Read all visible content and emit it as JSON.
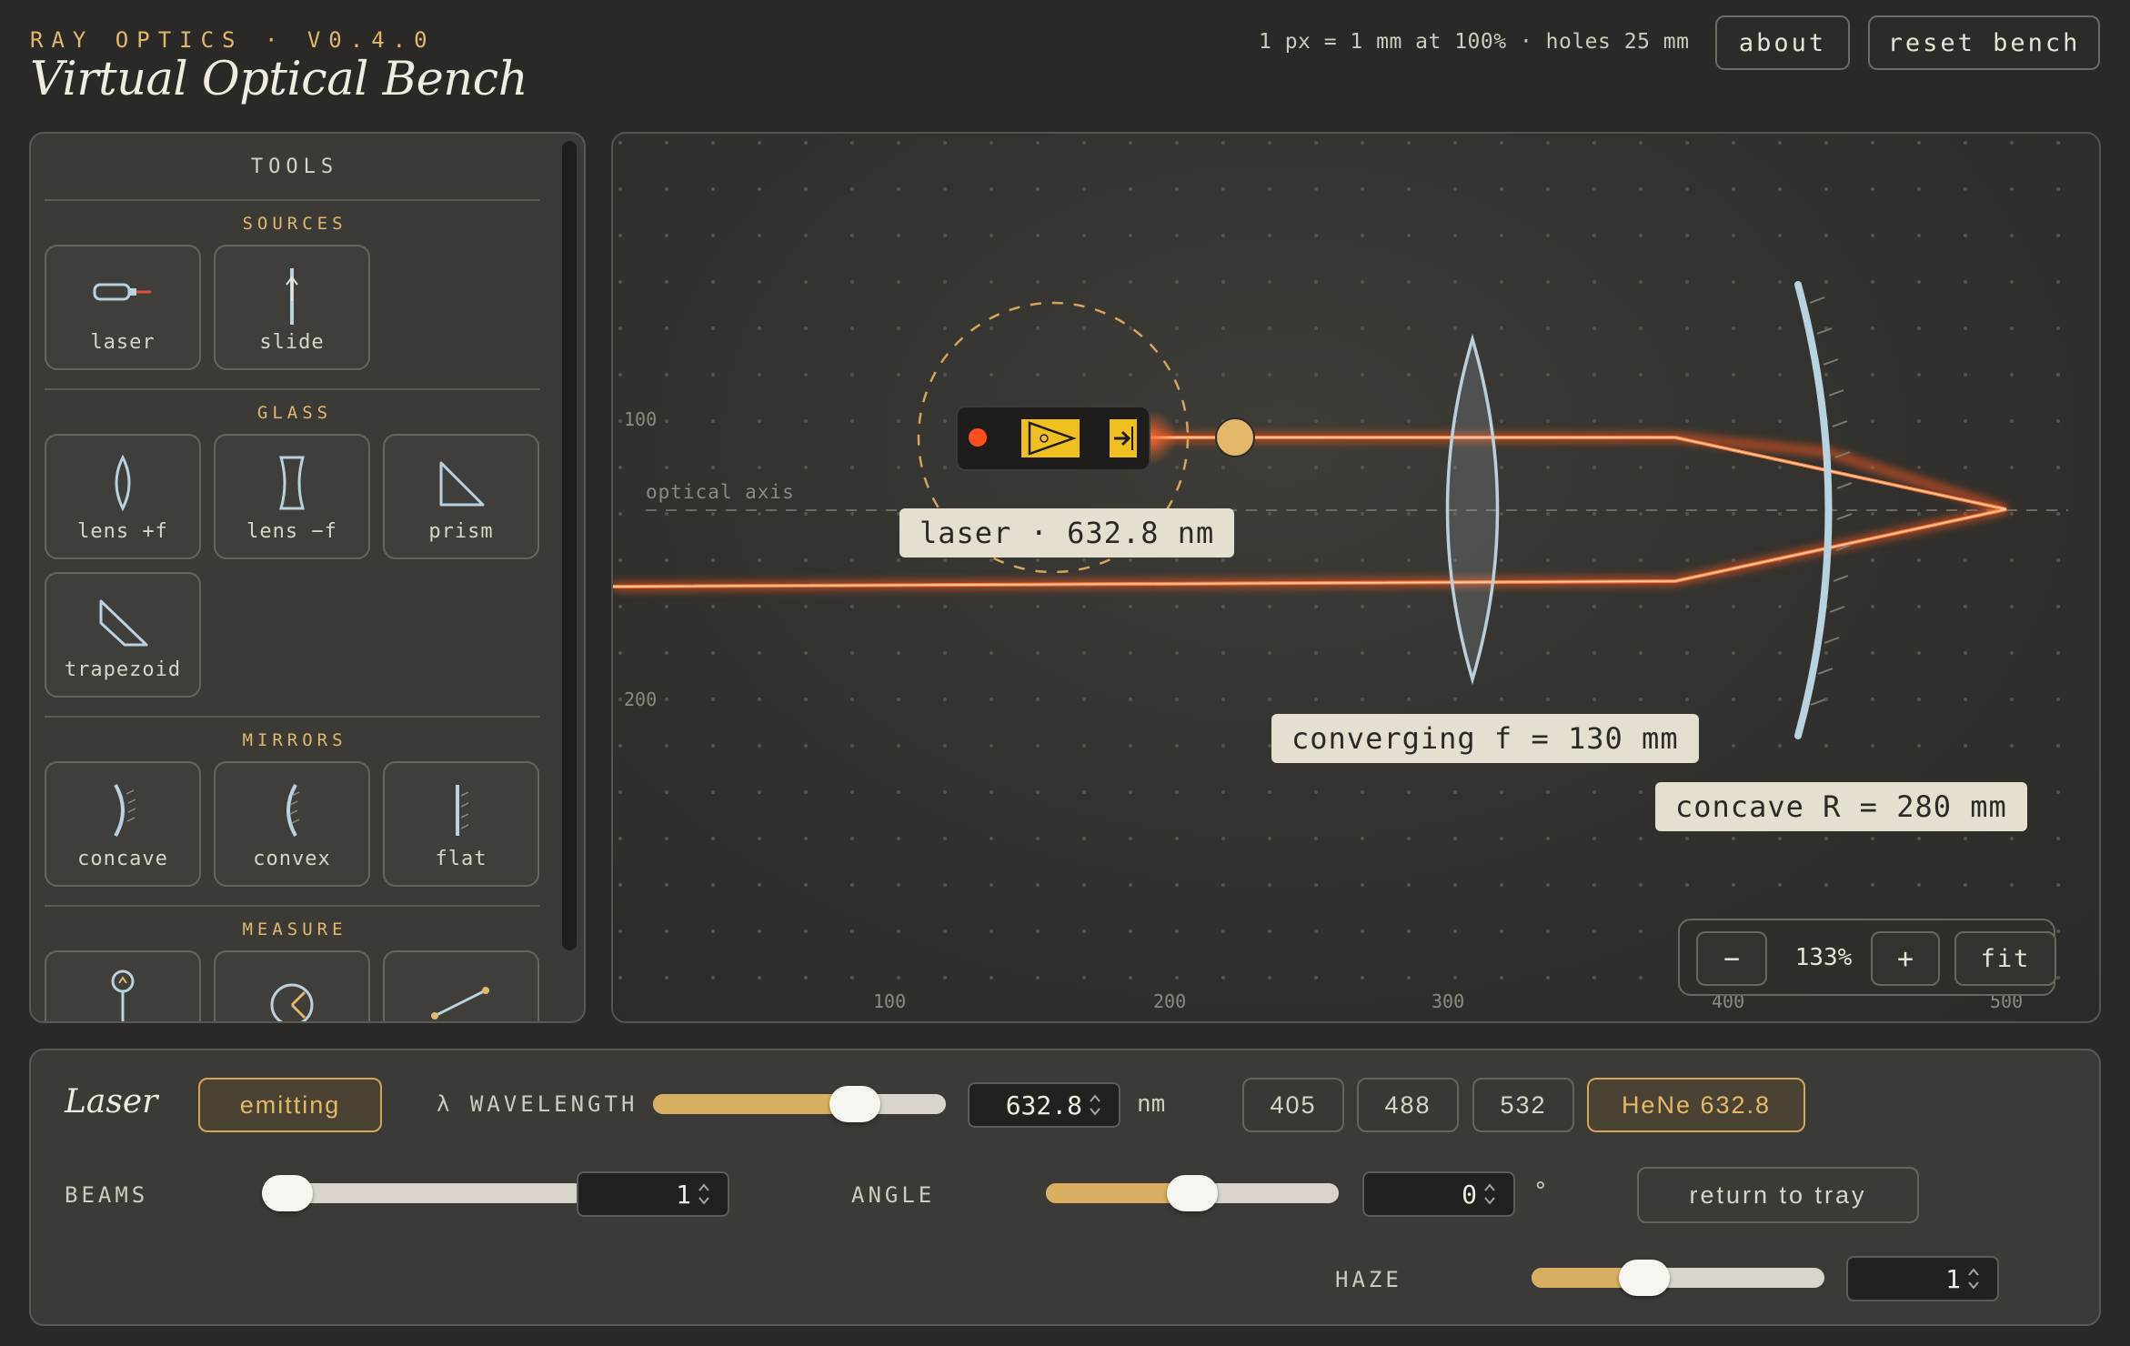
{
  "header": {
    "kicker": "RAY OPTICS · V0.4.0",
    "title": "Virtual Optical Bench",
    "scale_note": "1 px = 1 mm at 100% · holes 25 mm",
    "about_label": "about",
    "reset_label": "reset bench"
  },
  "tools": {
    "heading": "TOOLS",
    "sections": {
      "sources": "SOURCES",
      "glass": "GLASS",
      "mirrors": "MIRRORS",
      "measure": "MEASURE"
    },
    "items": {
      "laser": "laser",
      "slide": "slide",
      "lens_pos": "lens +f",
      "lens_neg": "lens −f",
      "prism": "prism",
      "trapezoid": "trapezoid",
      "concave": "concave",
      "convex": "convex",
      "flat": "flat"
    }
  },
  "canvas": {
    "optical_axis_label": "optical axis",
    "y_ticks": [
      "100",
      "200"
    ],
    "x_ticks": [
      "100",
      "200",
      "300",
      "400",
      "500"
    ],
    "laser_callout": "laser · 632.8 nm",
    "lens_callout": "converging f = 130 mm",
    "mirror_callout": "concave R = 280 mm",
    "beam_color": "#ff6a2a",
    "accent_color": "#e3b86a"
  },
  "zoom": {
    "minus_label": "−",
    "value": "133%",
    "plus_label": "+",
    "fit_label": "fit"
  },
  "inspector": {
    "title": "Laser",
    "state_label": "emitting",
    "wavelength_label": "λ WAVELENGTH",
    "wavelength_value": "632.8",
    "wavelength_unit": "nm",
    "wavelength_fraction": 0.73,
    "presets": [
      "405",
      "488",
      "532",
      "HeNe 632.8"
    ],
    "beams_label": "BEAMS",
    "beams_value": "1",
    "beams_fraction": 0.0,
    "angle_label": "ANGLE",
    "angle_value": "0",
    "angle_unit": "°",
    "angle_fraction": 0.5,
    "haze_label": "HAZE",
    "haze_value": "1",
    "haze_fraction": 0.36,
    "return_label": "return to tray"
  }
}
